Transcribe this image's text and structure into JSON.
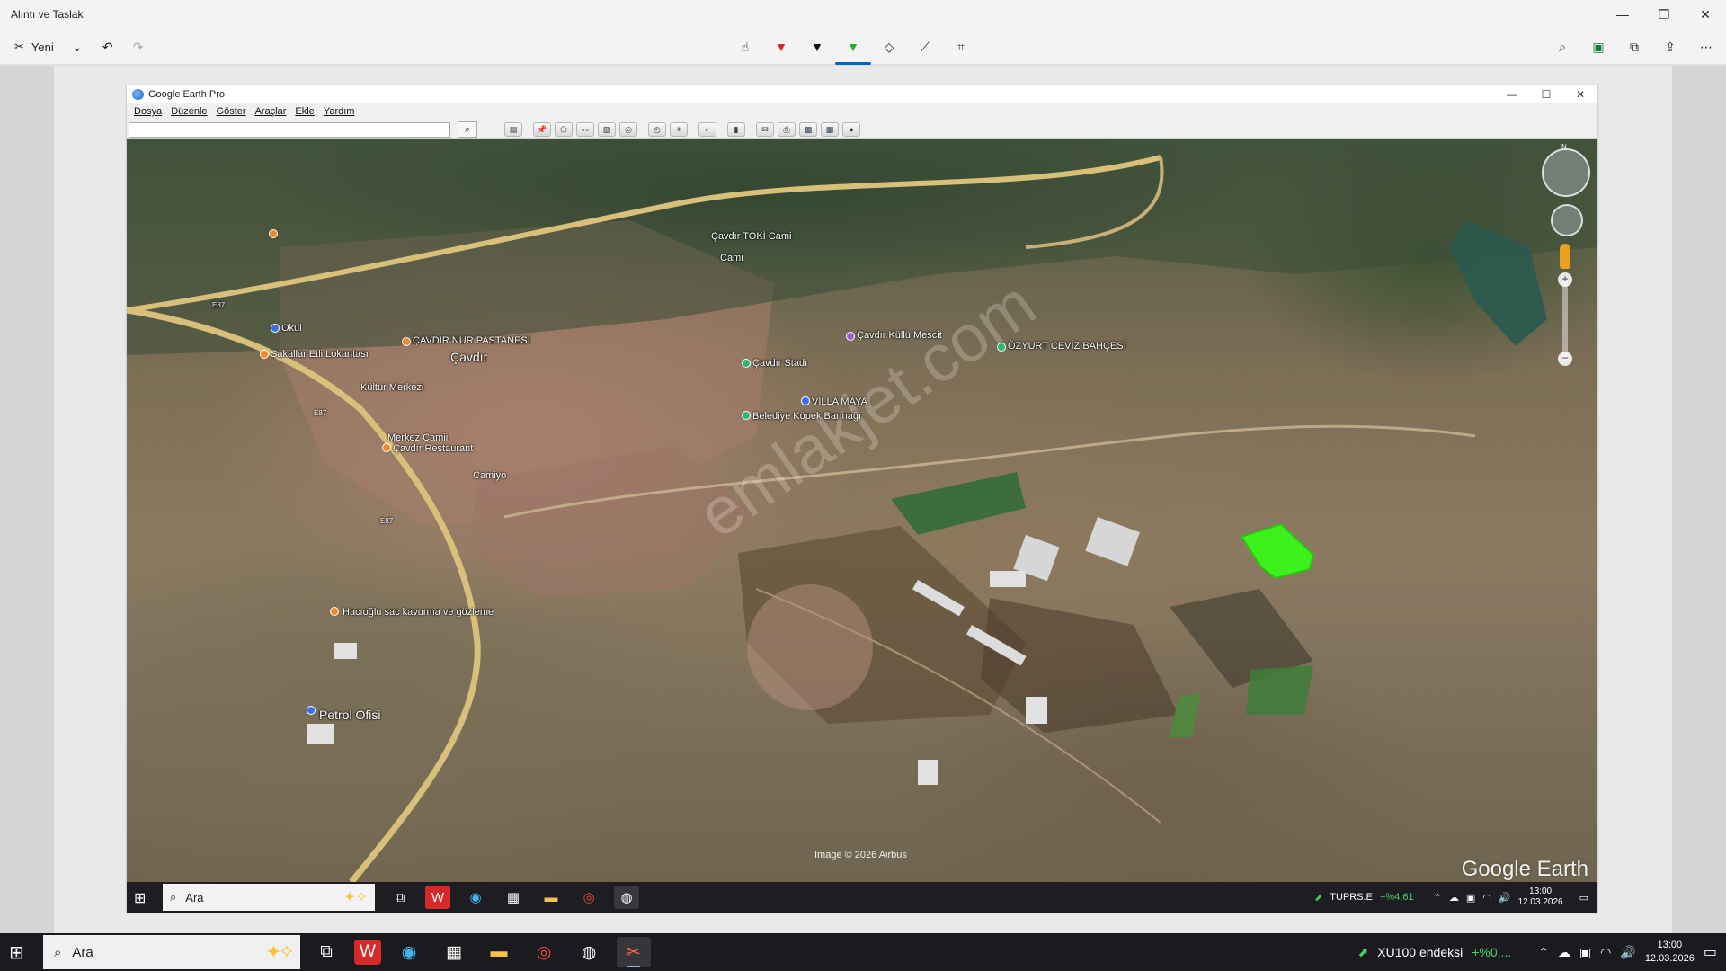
{
  "window": {
    "title": "Alıntı ve Taslak"
  },
  "toolbar": {
    "new_label": "Yeni"
  },
  "capture": {
    "title": "Google Earth Pro",
    "menus": [
      "Dosya",
      "Düzenle",
      "Göster",
      "Araçlar",
      "Ekle",
      "Yardım"
    ],
    "search_value": "",
    "labels": {
      "toki": "Çavdır TOKİ Cami",
      "cami": "Cami",
      "okul": "Okul",
      "pastane": "ÇAVDIR NUR PASTANESİ",
      "cavdir": "Çavdır",
      "lokanta": "Sakallar Etli Lokantası",
      "kultur": "Kültür Merkezi",
      "mescit": "Çavdır Küllü Mescit",
      "ceviz": "ÖZYURT CEVİZ BAHÇESİ",
      "stadi": "Çavdır Stadı",
      "villa": "VİLLA MAYA",
      "kopek": "Belediye Köpek Barınağı",
      "merkez_camii": "Merkez Camii",
      "restaurant": "Çavdır Restaurant",
      "acigoz": "Hacıoğlu sac kavurma ve gözleme",
      "petrol": "Petrol Ofisi",
      "e87_1": "E87",
      "e87_2": "E87",
      "e87_3": "E87",
      "camiyo": "Camiyo"
    },
    "watermark": "emlakjet.com",
    "copyright": "Image © 2026 Airbus",
    "brand": "Google Earth",
    "nav_north": "N",
    "inner_taskbar": {
      "search": "Ara",
      "stock_name": "TUPRS.E",
      "stock_change": "+%4,61",
      "time": "13:00",
      "date": "12.03.2026"
    }
  },
  "taskbar": {
    "search": "Ara",
    "stock_name": "XU100 endeksi",
    "stock_change": "+%0,...",
    "time": "13:00",
    "date": "12.03.2026"
  },
  "colors": {
    "highlight_parcel": "#3df21c",
    "accent": "#0067c0"
  }
}
